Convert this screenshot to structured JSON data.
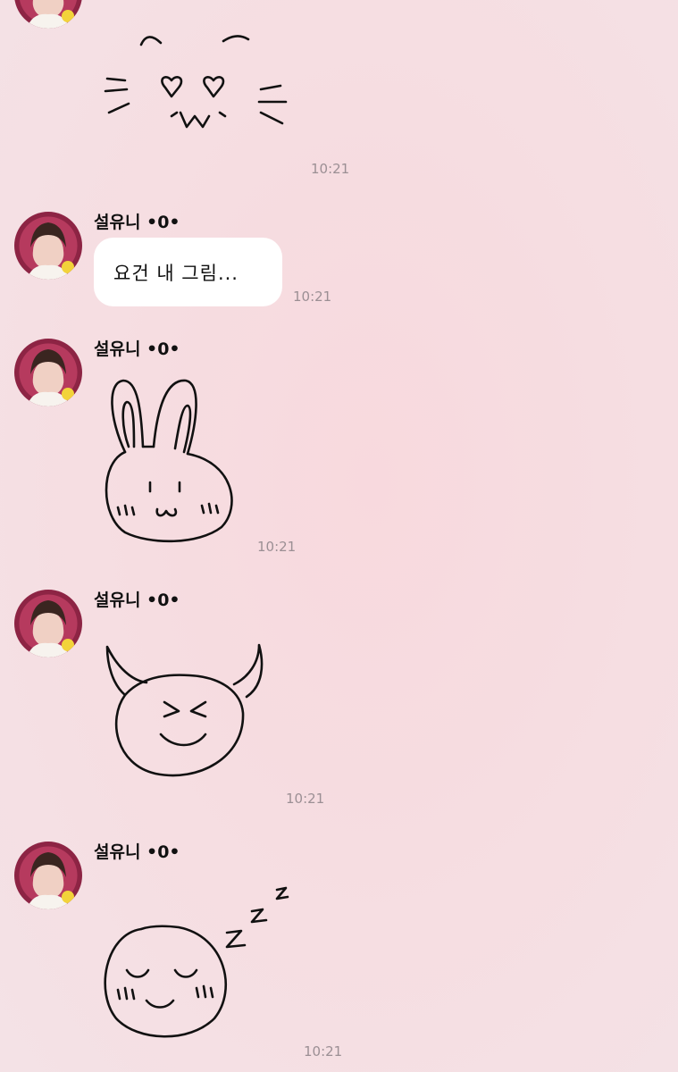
{
  "messages": [
    {
      "type": "sticker",
      "sticker": "cat-hearts-drawing",
      "time": "10:21"
    },
    {
      "sender": "설유니 •0•",
      "type": "text",
      "text": "요건 내 그림...",
      "time": "10:21"
    },
    {
      "sender": "설유니 •0•",
      "type": "sticker",
      "sticker": "bunny-drawing",
      "time": "10:21"
    },
    {
      "sender": "설유니 •0•",
      "type": "sticker",
      "sticker": "devil-drawing",
      "time": "10:21"
    },
    {
      "sender": "설유니 •0•",
      "type": "sticker",
      "sticker": "sleeping-face-drawing",
      "time": "10:21"
    }
  ],
  "colors": {
    "background": "#f6dde1",
    "bubble": "#ffffff",
    "timestamp": "#9b8f94",
    "ink": "#111111"
  }
}
